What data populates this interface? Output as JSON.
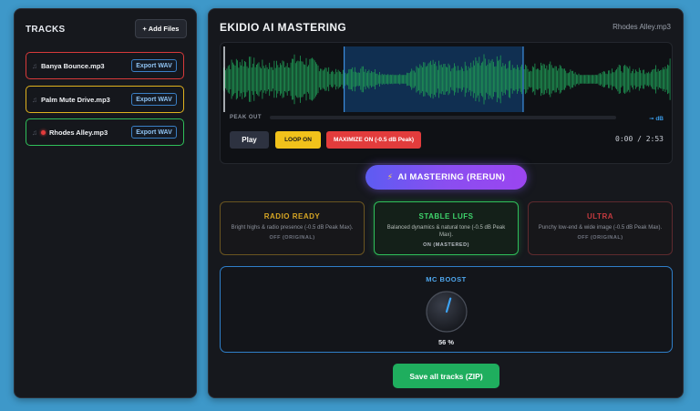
{
  "sidebar": {
    "title": "TRACKS",
    "add_files_label": "+ Add Files",
    "tracks": [
      {
        "name": "Banya Bounce.mp3",
        "export_label": "Export WAV",
        "border_color": "#d83a3a",
        "playing": false
      },
      {
        "name": "Palm Mute Drive.mp3",
        "export_label": "Export WAV",
        "border_color": "#e0b21e",
        "playing": false
      },
      {
        "name": "Rhodes Alley.mp3",
        "export_label": "Export WAV",
        "border_color": "#2fbf5a",
        "playing": true
      }
    ]
  },
  "header": {
    "title": "EKIDIO AI MASTERING",
    "current_file": "Rhodes Alley.mp3"
  },
  "waveform": {
    "color": "#1f9a55",
    "selection_start_fraction": 0.27,
    "selection_end_fraction": 0.67,
    "playhead_fraction": 0.0,
    "peak_out_label": "PEAK OUT",
    "db_label": "⊸ dB",
    "peak_level_fraction": 0.0
  },
  "controls": {
    "play_label": "Play",
    "loop_label": "LOOP ON",
    "maximize_label": "MAXIMIZE ON (-0.5 dB Peak)",
    "time_display": "0:00 / 2:53"
  },
  "mastering_button": {
    "icon": "lightning-icon",
    "label": "AI MASTERING (RERUN)"
  },
  "presets": [
    {
      "title": "RADIO READY",
      "desc": "Bright highs & radio presence (-0.5 dB Peak Max).",
      "status": "OFF (ORIGINAL)",
      "color": "#d7a624",
      "active": false
    },
    {
      "title": "STABLE LUFS",
      "desc": "Balanced dynamics & natural tone (-0.5 dB Peak Max).",
      "status": "ON (MASTERED)",
      "color": "#3fd46c",
      "active": true
    },
    {
      "title": "ULTRA",
      "desc": "Punchy low-end & wide image (-0.5 dB Peak Max).",
      "status": "OFF (ORIGINAL)",
      "color": "#c43a3f",
      "active": false
    }
  ],
  "mc_boost": {
    "title": "MC BOOST",
    "value": 56,
    "value_label": "56 %"
  },
  "save_all_label": "Save all tracks (ZIP)"
}
